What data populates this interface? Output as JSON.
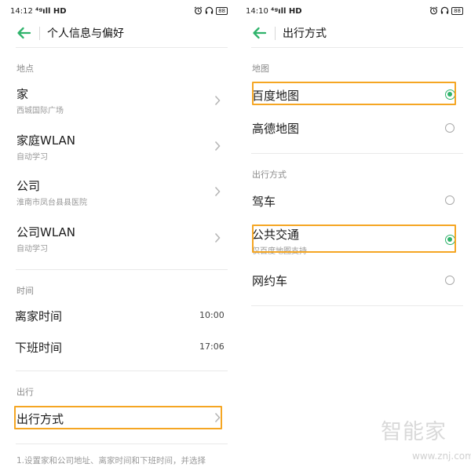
{
  "left": {
    "status": {
      "time": "14:12",
      "signal": "⁴ᵍıll HD",
      "battery": "88"
    },
    "header": {
      "title": "个人信息与偏好"
    },
    "sections": {
      "location": "地点",
      "time": "时间",
      "travel": "出行"
    },
    "location_items": [
      {
        "title": "家",
        "subtitle": "西城国际广场"
      },
      {
        "title": "家庭WLAN",
        "subtitle": "自动学习"
      },
      {
        "title": "公司",
        "subtitle": "淮南市凤台县县医院"
      },
      {
        "title": "公司WLAN",
        "subtitle": "自动学习"
      }
    ],
    "time_items": [
      {
        "title": "离家时间",
        "value": "10:00"
      },
      {
        "title": "下班时间",
        "value": "17:06"
      }
    ],
    "travel_item": {
      "title": "出行方式"
    },
    "note": "1.设置家和公司地址、离家时间和下班时间，并选择"
  },
  "right": {
    "status": {
      "time": "14:10",
      "signal": "⁴ᵍıll HD",
      "battery": "88"
    },
    "header": {
      "title": "出行方式"
    },
    "sections": {
      "map": "地图",
      "mode": "出行方式"
    },
    "map_options": [
      {
        "title": "百度地图",
        "selected": true
      },
      {
        "title": "高德地图",
        "selected": false
      }
    ],
    "mode_options": [
      {
        "title": "驾车",
        "selected": false
      },
      {
        "title": "公共交通",
        "subtitle": "仅百度地图支持",
        "selected": true
      },
      {
        "title": "网约车",
        "selected": false
      }
    ]
  },
  "watermark": {
    "logo": "智能家",
    "url": "www.znj.com"
  },
  "colors": {
    "accent": "#2fb36b",
    "highlight": "#f5a623",
    "divider": "#e9e9e9"
  },
  "icons": [
    "back-arrow-icon",
    "alarm-icon",
    "headphones-icon",
    "battery-icon",
    "chevron-right-icon",
    "radio-selected-icon",
    "radio-unselected-icon"
  ]
}
